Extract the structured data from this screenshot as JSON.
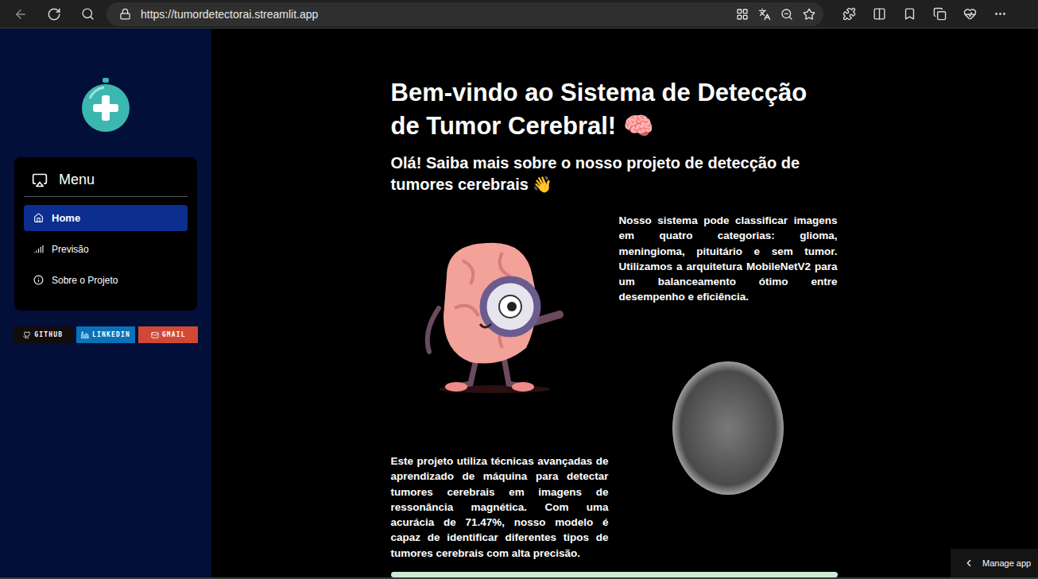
{
  "browser": {
    "url": "https://tumordetectorai.streamlit.app"
  },
  "sidebar": {
    "menu_title": "Menu",
    "items": [
      {
        "label": "Home",
        "selected": true,
        "icon": "home"
      },
      {
        "label": "Previsão",
        "selected": false,
        "icon": "chart"
      },
      {
        "label": "Sobre o Projeto",
        "selected": false,
        "icon": "info"
      }
    ],
    "badges": [
      {
        "label": "GITHUB",
        "color": "#120c0c",
        "icon": "github"
      },
      {
        "label": "LINKEDIN",
        "color": "#0a72b8",
        "icon": "linkedin"
      },
      {
        "label": "GMAIL",
        "color": "#d14836",
        "icon": "mail"
      }
    ]
  },
  "main": {
    "title": "Bem-vindo ao Sistema de Detecção de Tumor Cerebral! 🧠",
    "subtitle": "Olá! Saiba mais sobre o nosso projeto de detecção de tumores cerebrais 👋",
    "intro": "Nosso sistema pode classificar imagens em quatro categorias: glioma, meningioma, pituitário e sem tumor. Utilizamos a arquitetura MobileNetV2 para um balanceamento ótimo entre desempenho e eficiência.",
    "details": "Este projeto utiliza técnicas avançadas de aprendizado de máquina para detectar tumores cerebrais em imagens de ressonância magnética. Com uma acurácia de 71.47%, nosso modelo é capaz de identificar diferentes tipos de tumores cerebrais com alta precisão."
  },
  "manage_app": {
    "label": "Manage app"
  }
}
